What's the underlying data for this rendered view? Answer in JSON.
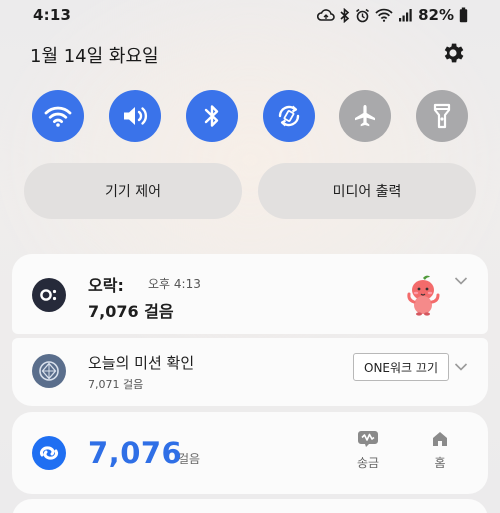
{
  "status_bar": {
    "time": "4:13",
    "battery": "82%",
    "icons": [
      "cloud-sync-icon",
      "bluetooth-icon",
      "alarm-icon",
      "wifi-icon",
      "signal-icon",
      "battery-icon"
    ]
  },
  "header": {
    "date": "1월 14일 화요일",
    "settings_icon": "gear-icon"
  },
  "quick_toggles": [
    {
      "icon": "wifi-icon",
      "state": "on"
    },
    {
      "icon": "sound-icon",
      "state": "on"
    },
    {
      "icon": "bluetooth-icon",
      "state": "on"
    },
    {
      "icon": "auto-rotate-icon",
      "state": "on"
    },
    {
      "icon": "airplane-icon",
      "state": "off"
    },
    {
      "icon": "flashlight-icon",
      "state": "off"
    }
  ],
  "pills": {
    "device_control": "기기 제어",
    "media_output": "미디어 출력"
  },
  "notifications": [
    {
      "app": "오락:",
      "time": "오후 4:13",
      "text": "7,076 걸음"
    },
    {
      "title": "오늘의 미션 확인",
      "subtitle": "7,071 걸음",
      "button": "ONE워크 끄기"
    },
    {
      "steps": "7,076",
      "unit": "걸음",
      "actions": [
        {
          "label": "송금",
          "icon": "send-money-icon"
        },
        {
          "label": "홈",
          "icon": "home-icon"
        }
      ]
    }
  ],
  "colors": {
    "accent": "#3a73ea",
    "toggle_off": "#a9a9ab",
    "steps_blue": "#2f6fe6"
  }
}
